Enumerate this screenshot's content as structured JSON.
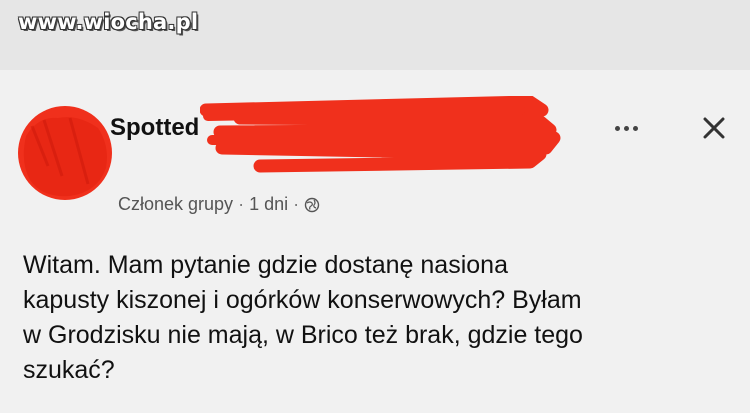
{
  "watermark": "www.wiocha.pl",
  "post": {
    "author": "Spotted",
    "meta": {
      "role": "Członek grupy",
      "time": "1 dni",
      "audience_icon": "globe-icon"
    },
    "lines": [
      "Witam. Mam pytanie gdzie dostanę nasiona",
      "kapusty kiszonej i ogórków konserwowych? Byłam",
      "w Grodzisku nie mają, w Brico też brak, gdzie tego",
      "szukać?"
    ]
  },
  "colors": {
    "redaction": "#f0301c",
    "background": "#f1f1f1",
    "text": "#111111",
    "meta_text": "#555555"
  }
}
